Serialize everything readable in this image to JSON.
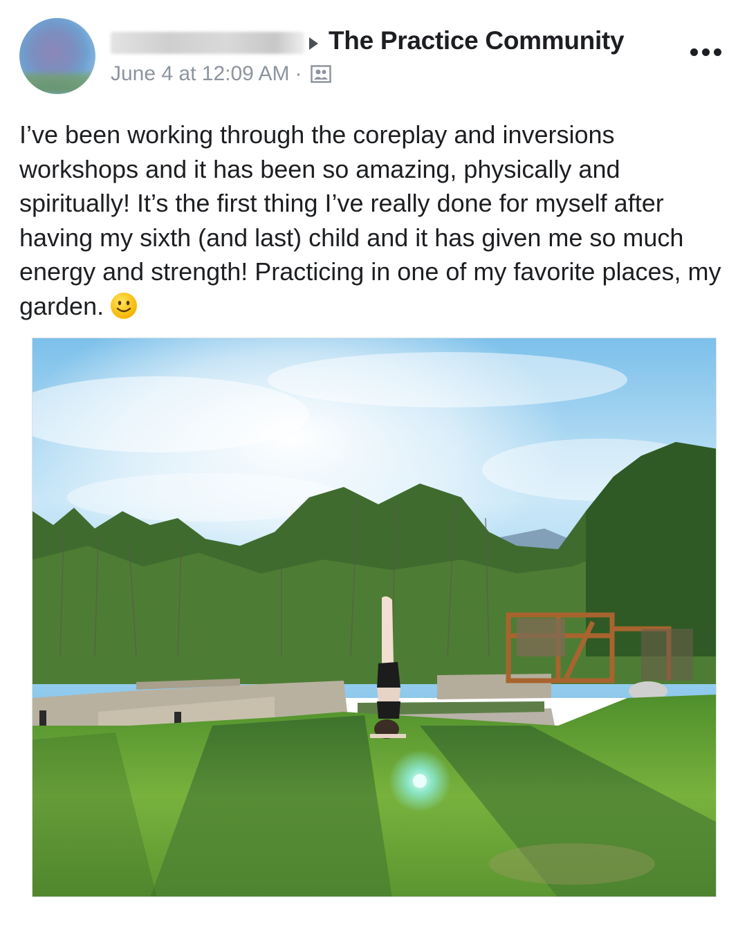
{
  "post": {
    "group_name": "The Practice Community",
    "timestamp": "June 4 at 12:09 AM",
    "separator": "·",
    "text": "I’ve been working through the coreplay and inversions workshops and it has been so amazing, physically and spiritually! It’s the first thing I’ve really done for myself after having my sixth (and last) child and it has given me so much energy and strength! Practicing in one of my favorite places, my garden.",
    "emoji": "slightly-smiling-face",
    "privacy_icon": "group-members-icon",
    "more_icon": "more-options-icon"
  },
  "photo": {
    "subject": "headstand-in-garden",
    "colors": {
      "sky": "#8ec9ec",
      "grass": "#6fa33b",
      "trees": "#3f6b2f"
    }
  }
}
